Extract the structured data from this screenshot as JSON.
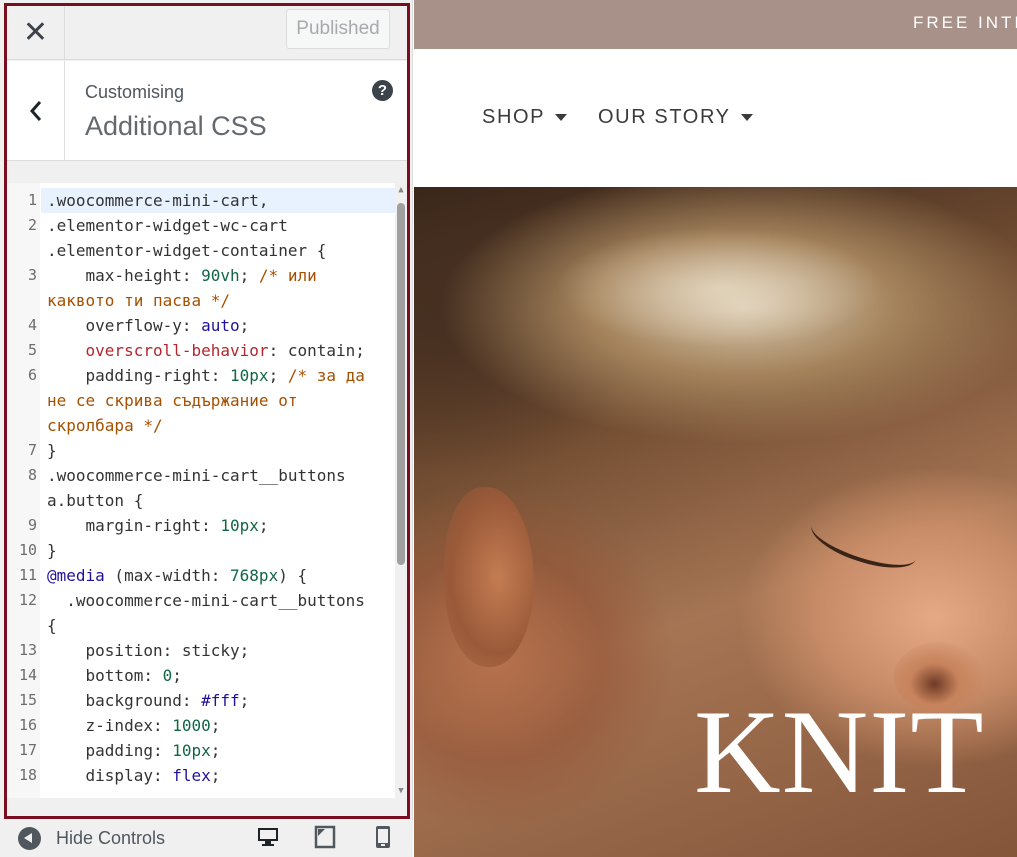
{
  "customizer": {
    "close_icon": "close-icon",
    "publish_label": "Published",
    "back_icon": "chevron-left-icon",
    "customising_label": "Customising",
    "section_title": "Additional CSS",
    "help_icon": "help-icon",
    "help_glyph": "?",
    "accent_color": "#7a0e21"
  },
  "editor": {
    "language": "css",
    "rows": [
      {
        "ln": "1",
        "active": true,
        "tokens": [
          {
            "t": ".woocommerce-mini-cart,",
            "c": "str"
          }
        ]
      },
      {
        "ln": "2",
        "tokens": [
          {
            "t": ".elementor-widget-wc-cart",
            "c": "str"
          }
        ]
      },
      {
        "ln": "",
        "tokens": [
          {
            "t": ".elementor-widget-container {",
            "c": "str"
          }
        ]
      },
      {
        "ln": "3",
        "tokens": [
          {
            "t": "    max-height: ",
            "c": "prop"
          },
          {
            "t": "90vh",
            "c": "num"
          },
          {
            "t": "; ",
            "c": "prop"
          },
          {
            "t": "/* или",
            "c": "comment"
          }
        ]
      },
      {
        "ln": "",
        "tokens": [
          {
            "t": "каквото ти пасва */",
            "c": "comment"
          }
        ]
      },
      {
        "ln": "4",
        "tokens": [
          {
            "t": "    overflow-y: ",
            "c": "prop"
          },
          {
            "t": "auto",
            "c": "kw"
          },
          {
            "t": ";",
            "c": "prop"
          }
        ]
      },
      {
        "ln": "5",
        "tokens": [
          {
            "t": "    overscroll-behavior",
            "c": "prop2"
          },
          {
            "t": ": contain;",
            "c": "prop"
          }
        ]
      },
      {
        "ln": "6",
        "tokens": [
          {
            "t": "    padding-right: ",
            "c": "prop"
          },
          {
            "t": "10px",
            "c": "num"
          },
          {
            "t": "; ",
            "c": "prop"
          },
          {
            "t": "/* за да",
            "c": "comment"
          }
        ]
      },
      {
        "ln": "",
        "tokens": [
          {
            "t": "не се скрива съдържание от",
            "c": "comment"
          }
        ]
      },
      {
        "ln": "",
        "tokens": [
          {
            "t": "скролбара */",
            "c": "comment"
          }
        ]
      },
      {
        "ln": "7",
        "tokens": [
          {
            "t": "}",
            "c": "prop"
          }
        ]
      },
      {
        "ln": "8",
        "tokens": [
          {
            "t": ".woocommerce-mini-cart__buttons",
            "c": "str"
          }
        ]
      },
      {
        "ln": "",
        "tokens": [
          {
            "t": "a.button {",
            "c": "str"
          }
        ]
      },
      {
        "ln": "9",
        "tokens": [
          {
            "t": "    margin-right: ",
            "c": "prop"
          },
          {
            "t": "10px",
            "c": "num"
          },
          {
            "t": ";",
            "c": "prop"
          }
        ]
      },
      {
        "ln": "10",
        "tokens": [
          {
            "t": "}",
            "c": "prop"
          }
        ]
      },
      {
        "ln": "11",
        "tokens": [
          {
            "t": "@media",
            "c": "kw"
          },
          {
            "t": " (max-width: ",
            "c": "prop"
          },
          {
            "t": "768px",
            "c": "num"
          },
          {
            "t": ") {",
            "c": "prop"
          }
        ]
      },
      {
        "ln": "12",
        "tokens": [
          {
            "t": "  .woocommerce-mini-cart__buttons",
            "c": "str"
          }
        ]
      },
      {
        "ln": "",
        "tokens": [
          {
            "t": "{",
            "c": "prop"
          }
        ]
      },
      {
        "ln": "13",
        "tokens": [
          {
            "t": "    position: sticky;",
            "c": "prop"
          }
        ]
      },
      {
        "ln": "14",
        "tokens": [
          {
            "t": "    bottom: ",
            "c": "prop"
          },
          {
            "t": "0",
            "c": "num"
          },
          {
            "t": ";",
            "c": "prop"
          }
        ]
      },
      {
        "ln": "15",
        "tokens": [
          {
            "t": "    background: ",
            "c": "prop"
          },
          {
            "t": "#fff",
            "c": "kw"
          },
          {
            "t": ";",
            "c": "prop"
          }
        ]
      },
      {
        "ln": "16",
        "tokens": [
          {
            "t": "    z-index: ",
            "c": "prop"
          },
          {
            "t": "1000",
            "c": "num"
          },
          {
            "t": ";",
            "c": "prop"
          }
        ]
      },
      {
        "ln": "17",
        "tokens": [
          {
            "t": "    padding: ",
            "c": "prop"
          },
          {
            "t": "10px",
            "c": "num"
          },
          {
            "t": ";",
            "c": "prop"
          }
        ]
      },
      {
        "ln": "18",
        "tokens": [
          {
            "t": "    display: ",
            "c": "prop"
          },
          {
            "t": "flex",
            "c": "kw"
          },
          {
            "t": ";",
            "c": "prop"
          }
        ]
      }
    ]
  },
  "footer": {
    "hide_controls_label": "Hide Controls",
    "devices": [
      "desktop-icon",
      "tablet-icon",
      "mobile-icon"
    ]
  },
  "preview": {
    "announcement": "FREE INTE",
    "nav": [
      {
        "label": "SHOP"
      },
      {
        "label": "OUR STORY"
      }
    ],
    "hero_title": "KNIT",
    "announcement_color": "#a89189"
  }
}
